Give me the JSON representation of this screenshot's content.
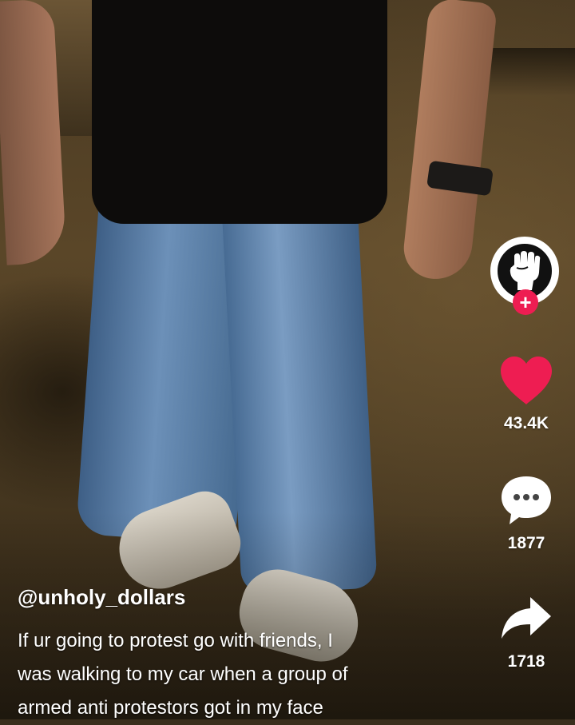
{
  "author": {
    "username": "@unholy_dollars",
    "avatar_icon": "raised-fist-icon",
    "follow_label": "+"
  },
  "caption": {
    "lines": [
      "If ur going to protest go with friends, I",
      "was walking to my car when a group of",
      "armed anti protestors got in my face"
    ]
  },
  "actions": {
    "likes": {
      "icon": "heart-icon",
      "count": "43.4K",
      "color": "#ee1d52"
    },
    "comments": {
      "icon": "comment-bubble-icon",
      "count": "1877"
    },
    "shares": {
      "icon": "share-arrow-icon",
      "count": "1718"
    }
  }
}
